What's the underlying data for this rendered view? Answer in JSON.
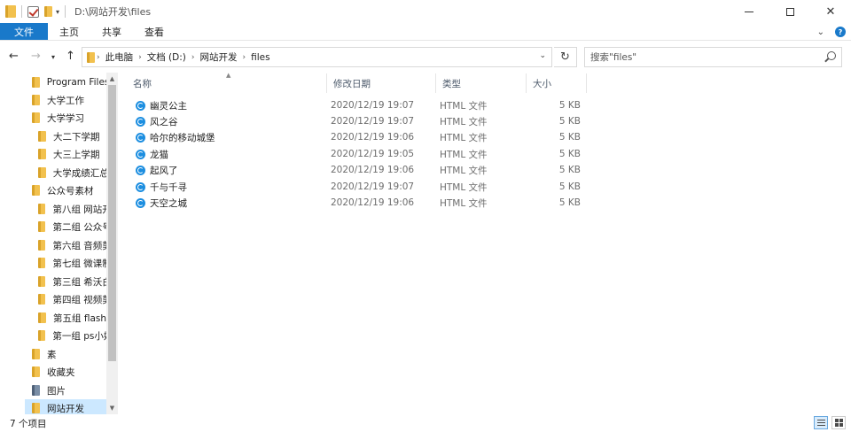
{
  "title_bar": {
    "path": "D:\\网站开发\\files",
    "minimize": "—",
    "close": "✕"
  },
  "ribbon": {
    "tabs": [
      {
        "label": "文件"
      },
      {
        "label": "主页"
      },
      {
        "label": "共享"
      },
      {
        "label": "查看"
      }
    ]
  },
  "address": {
    "breadcrumbs": [
      "此电脑",
      "文档 (D:)",
      "网站开发",
      "files"
    ]
  },
  "search": {
    "placeholder": "搜索\"files\""
  },
  "sidebar": {
    "items": [
      {
        "label": "Program Files",
        "selected": false
      },
      {
        "label": "大学工作",
        "selected": false
      },
      {
        "label": "大学学习",
        "selected": false
      },
      {
        "label": "大二下学期",
        "selected": false
      },
      {
        "label": "大三上学期",
        "selected": false
      },
      {
        "label": "大学成绩汇总",
        "selected": false
      },
      {
        "label": "公众号素材",
        "selected": false
      },
      {
        "label": "第八组 网站开",
        "selected": false
      },
      {
        "label": "第二组 公众号",
        "selected": false
      },
      {
        "label": "第六组 音频剪",
        "selected": false
      },
      {
        "label": "第七组 微课制",
        "selected": false
      },
      {
        "label": "第三组 希沃白",
        "selected": false
      },
      {
        "label": "第四组 视频剪",
        "selected": false
      },
      {
        "label": "第五组 flash",
        "selected": false
      },
      {
        "label": "第一组 ps小妹",
        "selected": false
      },
      {
        "label": "素",
        "selected": false
      },
      {
        "label": "收藏夹",
        "selected": false
      },
      {
        "label": "图片",
        "selected": false
      },
      {
        "label": "网站开发",
        "selected": true
      }
    ]
  },
  "file_list": {
    "columns": {
      "name": "名称",
      "modified": "修改日期",
      "type": "类型",
      "size": "大小"
    },
    "rows": [
      {
        "name": "幽灵公主",
        "modified": "2020/12/19 19:07",
        "type": "HTML 文件",
        "size": "5 KB"
      },
      {
        "name": "风之谷",
        "modified": "2020/12/19 19:07",
        "type": "HTML 文件",
        "size": "5 KB"
      },
      {
        "name": "哈尔的移动城堡",
        "modified": "2020/12/19 19:06",
        "type": "HTML 文件",
        "size": "5 KB"
      },
      {
        "name": "龙猫",
        "modified": "2020/12/19 19:05",
        "type": "HTML 文件",
        "size": "5 KB"
      },
      {
        "name": "起风了",
        "modified": "2020/12/19 19:06",
        "type": "HTML 文件",
        "size": "5 KB"
      },
      {
        "name": "千与千寻",
        "modified": "2020/12/19 19:07",
        "type": "HTML 文件",
        "size": "5 KB"
      },
      {
        "name": "天空之城",
        "modified": "2020/12/19 19:06",
        "type": "HTML 文件",
        "size": "5 KB"
      }
    ]
  },
  "status_bar": {
    "item_count": "7 个项目"
  },
  "colors": {
    "accent": "#1979ca",
    "selection": "#cce8ff",
    "folder": "#f2c14e"
  }
}
